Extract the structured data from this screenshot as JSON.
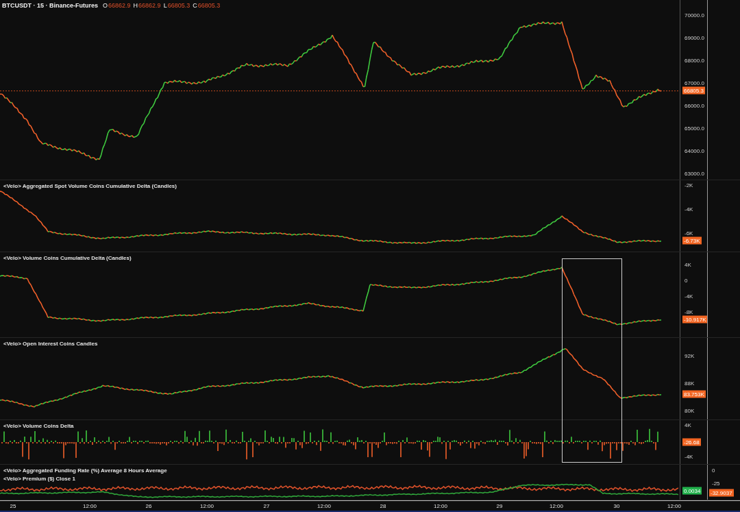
{
  "header": {
    "symbol": "BTCUSDT · 15 · Binance-Futures",
    "ohlc": [
      {
        "label": "O",
        "value": "66862.9"
      },
      {
        "label": "H",
        "value": "66862.9"
      },
      {
        "label": "L",
        "value": "66805.3"
      },
      {
        "label": "C",
        "value": "66805.3"
      }
    ]
  },
  "panels": [
    {
      "kind": "price",
      "ticks": [
        "70000.0",
        "69000.0",
        "68000.0",
        "67000.0",
        "66000.0",
        "65000.0",
        "64000.0",
        "63000.0"
      ],
      "badge": {
        "text": "66805.3",
        "color": "#f26522"
      }
    },
    {
      "kind": "spot_cvd",
      "titles": [
        "<Velo> Aggregated Spot Volume Coins Cumulative Delta (Candles)"
      ],
      "ticks": [
        "-2K",
        "-4K",
        "-6K"
      ],
      "badge": {
        "text": "-6.73K",
        "color": "#f26522"
      }
    },
    {
      "kind": "cvd",
      "titles": [
        "<Velo> Volume Coins Cumulative Delta (Candles)"
      ],
      "ticks": [
        "4K",
        "0",
        "-4K",
        "-8K"
      ],
      "badge": {
        "text": "-10.917K",
        "color": "#f26522"
      }
    },
    {
      "kind": "oi",
      "titles": [
        "<Velo> Open Interest Coins Candles"
      ],
      "ticks": [
        "92K",
        "88K",
        "80K"
      ],
      "badge": {
        "text": "83.753K",
        "color": "#f26522"
      }
    },
    {
      "kind": "volume_delta",
      "titles": [
        "<Velo> Volume Coins Delta"
      ],
      "ticks": [
        "4K",
        "-4K"
      ],
      "badge": {
        "text": "-26.68",
        "color": "#f26522"
      }
    },
    {
      "kind": "funding",
      "titles": [
        "<Velo> Aggregated Funding Rate (%) Average 8 Hours Average",
        "<Velo> Premium ($) Close 1"
      ],
      "badge": {
        "text": "0.0034",
        "color": "#22b14c"
      },
      "extra_ticks": [
        "0",
        "-25"
      ],
      "extra_badge": {
        "text": "-32.9037",
        "color": "#f26522"
      }
    }
  ],
  "time_axis": [
    "25",
    "12:00",
    "26",
    "12:00",
    "27",
    "12:00",
    "28",
    "12:00",
    "29",
    "12:00",
    "30",
    "12:00"
  ]
}
